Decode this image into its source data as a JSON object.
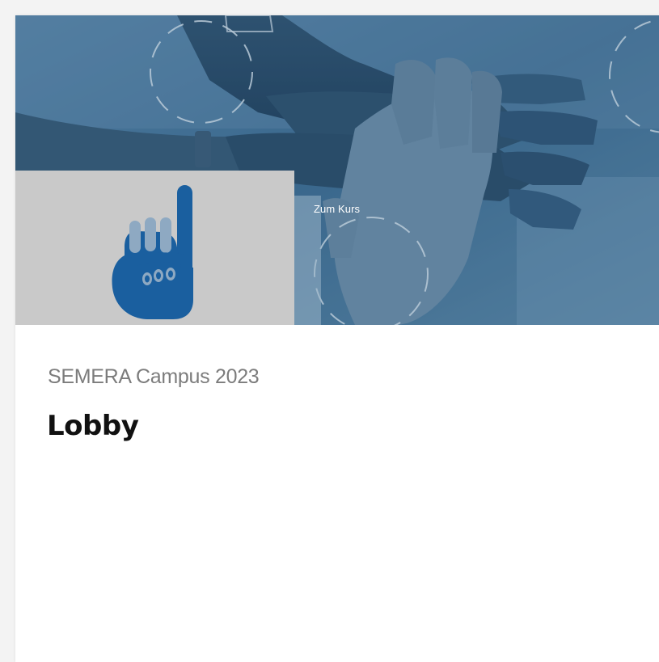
{
  "card": {
    "image_link_label": "Zum Kurs",
    "category": "SEMERA Campus 2023",
    "title": "Lobby"
  },
  "icons": {
    "logo": "raised-index-finger-hand-logo"
  },
  "colors": {
    "hero_overlay": "#3e6e93",
    "logo_box_bg": "#c9c9c9",
    "logo_blue": "#1a5f9f",
    "category_text": "#7c7c7c",
    "title_text": "#111111"
  }
}
